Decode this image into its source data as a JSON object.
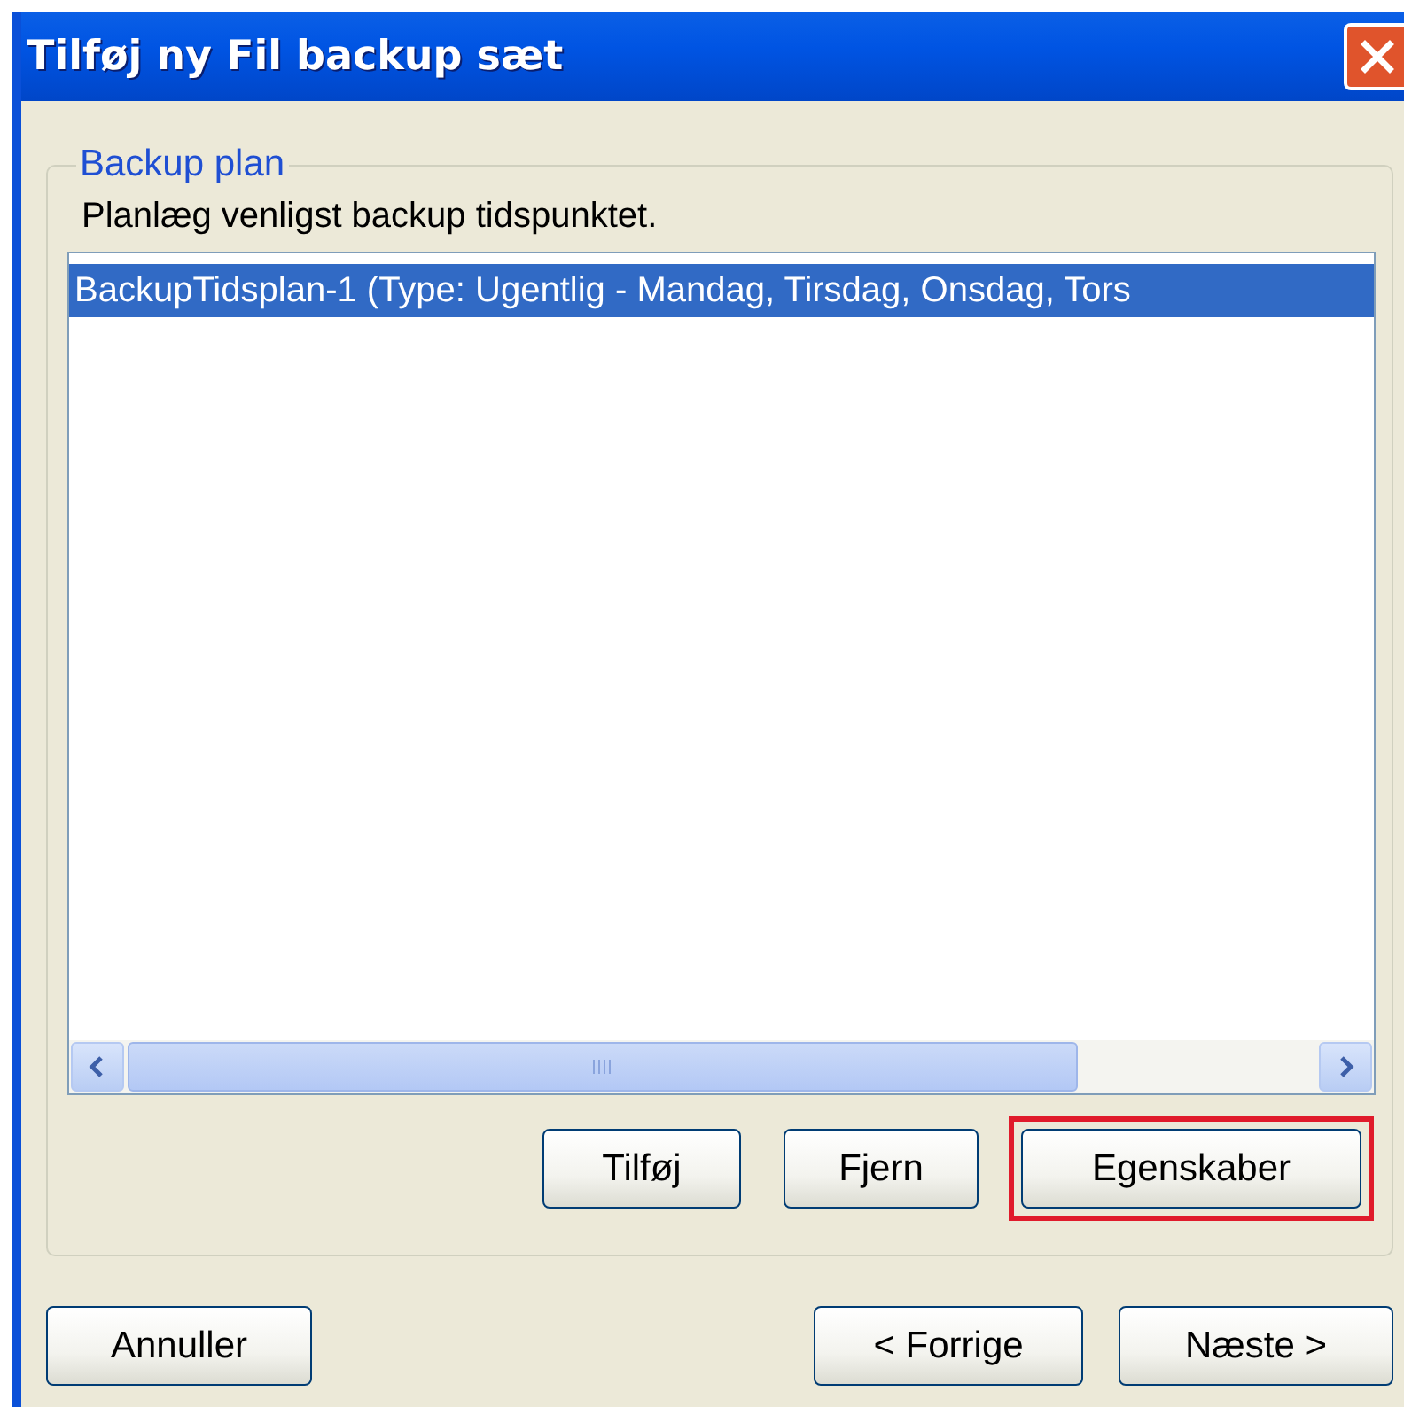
{
  "window": {
    "title": "Tilføj ny Fil backup sæt"
  },
  "group": {
    "legend": "Backup plan",
    "instruction": "Planlæg venligst backup tidspunktet.",
    "rows": [
      {
        "text": "BackupTidsplan-1 (Type: Ugentlig - Mandag, Tirsdag, Onsdag, Tors",
        "selected": true
      }
    ],
    "buttons": [
      {
        "label": "Tilføj",
        "highlighted": false
      },
      {
        "label": "Fjern",
        "highlighted": false
      },
      {
        "label": "Egenskaber",
        "highlighted": true
      }
    ]
  },
  "footer": {
    "cancel": "Annuller",
    "back": "< Forrige",
    "next": "Næste >"
  }
}
